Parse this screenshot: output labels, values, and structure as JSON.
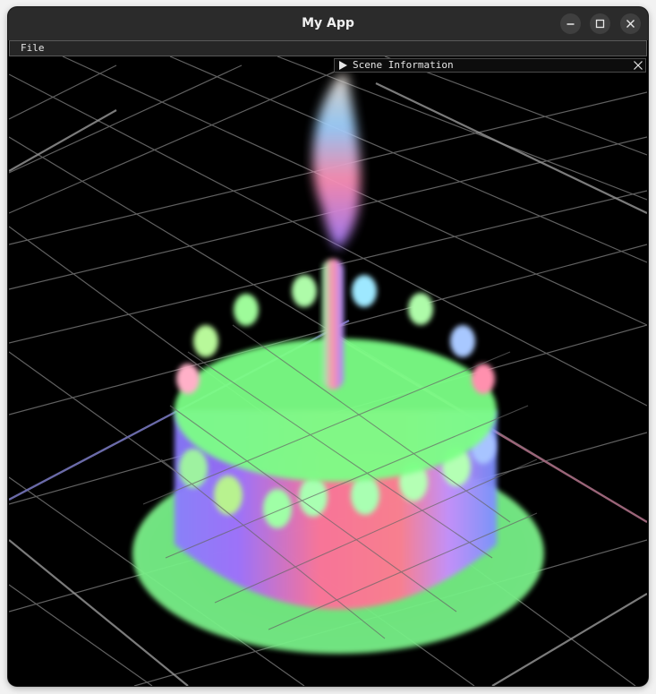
{
  "window": {
    "title": "My App",
    "controls": {
      "minimize_icon": "minimize-icon",
      "maximize_icon": "maximize-icon",
      "close_icon": "close-icon"
    }
  },
  "menubar": {
    "items": [
      {
        "label": "File"
      }
    ]
  },
  "scene_panel": {
    "title": "Scene Information",
    "collapsed": true,
    "expand_icon": "triangle-right-icon",
    "close_icon": "close-icon"
  },
  "viewport": {
    "description_colors": {
      "background": "#000000",
      "grid": "#7a7a7a",
      "axis_x": "#8a5a6a",
      "axis_z": "#5a5a8a",
      "normal_green": "#77ff88",
      "normal_pink": "#ff7a9a",
      "normal_blue": "#7a88ff"
    }
  }
}
